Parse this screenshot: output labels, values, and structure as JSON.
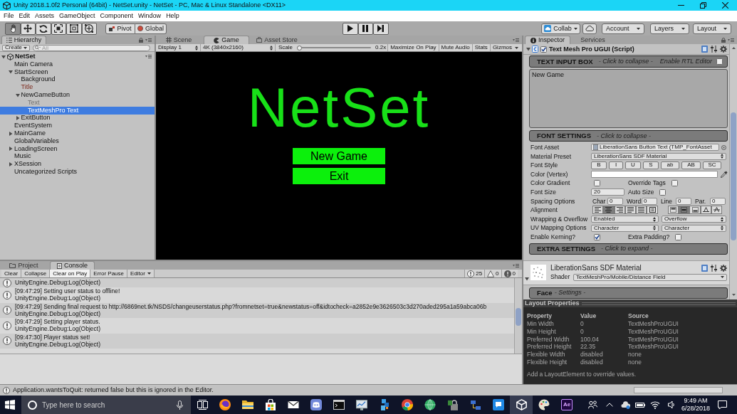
{
  "window": {
    "title": "Unity 2018.1.0f2 Personal (64bit) - NetSet.unity - NetSet - PC, Mac & Linux Standalone <DX11>"
  },
  "menu": [
    "File",
    "Edit",
    "Assets",
    "GameObject",
    "Component",
    "Window",
    "Help"
  ],
  "toolbar": {
    "tools": [
      {
        "kind": "hand",
        "selected": true
      },
      {
        "kind": "move",
        "selected": false
      },
      {
        "kind": "rotate",
        "selected": false
      },
      {
        "kind": "scale",
        "selected": false
      },
      {
        "kind": "rect",
        "selected": false
      },
      {
        "kind": "transform",
        "selected": false
      }
    ],
    "pivot": "Pivot",
    "space": "Global",
    "collab": "Collab",
    "account": "Account",
    "layers": "Layers",
    "layout": "Layout"
  },
  "hierarchy": {
    "tab": "Hierarchy",
    "create": "Create",
    "search": {
      "placeholder": "All"
    },
    "scene": {
      "name": "NetSet",
      "expanded": true,
      "children": [
        {
          "name": "Main Camera",
          "kind": "object",
          "selected": false
        },
        {
          "name": "StartScreen",
          "kind": "object",
          "selected": false,
          "expanded": true,
          "children": [
            {
              "name": "Background",
              "kind": "object",
              "selected": false
            },
            {
              "name": "Title",
              "kind": "missing_prefab",
              "selected": false
            },
            {
              "name": "NewGameButton",
              "kind": "object",
              "selected": false,
              "expanded": true,
              "children": [
                {
                  "name": "Text",
                  "kind": "inactive",
                  "selected": false
                },
                {
                  "name": "TextMeshPro Text",
                  "kind": "object",
                  "selected": true
                }
              ]
            },
            {
              "name": "ExitButton",
              "kind": "object",
              "selected": false,
              "expanded": false
            }
          ]
        },
        {
          "name": "EventSystem",
          "kind": "object",
          "selected": false
        },
        {
          "name": "MainGame",
          "kind": "object",
          "selected": false,
          "expanded": false
        },
        {
          "name": "GlobalVariables",
          "kind": "object",
          "selected": false
        },
        {
          "name": "LoadingScreen",
          "kind": "object",
          "selected": false,
          "expanded": false
        },
        {
          "name": "Music",
          "kind": "object",
          "selected": false
        },
        {
          "name": "XSession",
          "kind": "object",
          "selected": false,
          "expanded": false
        },
        {
          "name": "Uncategorized Scripts",
          "kind": "object",
          "selected": false
        }
      ]
    }
  },
  "view": {
    "tabs": [
      {
        "label": "Scene",
        "kind": "scene",
        "selected": false
      },
      {
        "label": "Game",
        "kind": "game",
        "selected": true
      },
      {
        "label": "Asset Store",
        "kind": "store",
        "selected": false
      }
    ],
    "display": "Display 1",
    "resolution": "4K (3840x2160)",
    "scale_label": "Scale",
    "scale": {
      "level": 0.03
    },
    "scale_value": "0.2x",
    "toggles": [
      {
        "label": "Maximize On Play",
        "on": false
      },
      {
        "label": "Mute Audio",
        "on": false
      },
      {
        "label": "Stats",
        "on": false
      }
    ],
    "gizmos": "Gizmos",
    "game": {
      "title": "NetSet",
      "buttons": [
        "New Game",
        "Exit"
      ]
    }
  },
  "inspector": {
    "tabs": [
      {
        "label": "Inspector",
        "kind": "inspector",
        "selected": true
      },
      {
        "label": "Services",
        "kind": "services",
        "selected": false
      }
    ],
    "component": {
      "title": "Text Mesh Pro UGUI (Script)",
      "expanded": true,
      "enabled": true
    },
    "text_input": {
      "heading": "TEXT INPUT BOX",
      "hint": "- Click to collapse -",
      "rtl_label": "Enable RTL Editor",
      "rtl_checked": false,
      "text": "New Game"
    },
    "font_settings": {
      "heading": "FONT SETTINGS",
      "hint": "- Click to collapse -",
      "rows": [
        {
          "kind": "object",
          "label": "Font Asset",
          "value": "LiberationSans Button Text (TMP_FontAsset"
        },
        {
          "kind": "dropdown",
          "label": "Material Preset",
          "value": "LiberationSans SDF Material"
        },
        {
          "kind": "buttons",
          "label": "Font Style",
          "buttons": [
            {
              "label": "B",
              "selected": false
            },
            {
              "label": "I",
              "selected": false
            },
            {
              "label": "U",
              "selected": false
            },
            {
              "label": "S",
              "selected": false
            },
            {
              "label": "ab",
              "selected": false
            },
            {
              "label": "AB",
              "selected": false
            },
            {
              "label": "SC",
              "selected": false
            }
          ]
        },
        {
          "kind": "color",
          "label": "Color (Vertex)",
          "color": "#ffffff"
        },
        {
          "kind": "toggles",
          "label": "Color Gradient",
          "checked": false,
          "label_2": "Override Tags",
          "checked_2": false
        },
        {
          "kind": "number",
          "label": "Font Size",
          "value": "20",
          "label_2": "Auto Size",
          "checked_2": false
        },
        {
          "kind": "spacing",
          "label": "Spacing Options",
          "fields": [
            {
              "label": "Char",
              "value": "0"
            },
            {
              "label": "Word",
              "value": "0"
            },
            {
              "label": "Line",
              "value": "0"
            },
            {
              "label": "Par.",
              "value": "0"
            }
          ]
        },
        {
          "kind": "alignment",
          "label": "Alignment",
          "horizontal": [
            {
              "kind": "left",
              "selected": false
            },
            {
              "kind": "center",
              "selected": true
            },
            {
              "kind": "right",
              "selected": false
            },
            {
              "kind": "justified",
              "selected": false
            },
            {
              "kind": "flush",
              "selected": false
            },
            {
              "kind": "geometry",
              "selected": false
            }
          ],
          "vertical": [
            {
              "kind": "top",
              "selected": false
            },
            {
              "kind": "middle",
              "selected": true
            },
            {
              "kind": "bottom",
              "selected": false
            },
            {
              "kind": "baseline",
              "selected": false
            },
            {
              "kind": "midline",
              "selected": false
            }
          ]
        },
        {
          "kind": "dropdowns",
          "label": "Wrapping & Overflow",
          "value": "Enabled",
          "value_2": "Overflow"
        },
        {
          "kind": "dropdowns",
          "label": "UV Mapping Options",
          "value": "Character",
          "value_2": "Character"
        },
        {
          "kind": "toggles",
          "label": "Enable Kerning?",
          "checked": true,
          "label_2": "Extra Padding?",
          "checked_2": false
        }
      ]
    },
    "extra_settings": {
      "heading": "EXTRA SETTINGS",
      "hint": "- Click to expand -"
    },
    "material": {
      "name": "LiberationSans SDF Material",
      "shader_label": "Shader",
      "shader": "TextMeshPro/Mobile/Distance Field"
    },
    "face": {
      "heading": "Face",
      "hint": "- Settings -"
    }
  },
  "layout_properties": {
    "title": "Layout Properties",
    "columns": [
      "Property",
      "Value",
      "Source"
    ],
    "rows": [
      [
        "Min Width",
        "0",
        "TextMeshProUGUI"
      ],
      [
        "Min Height",
        "0",
        "TextMeshProUGUI"
      ],
      [
        "Preferred Width",
        "100.04",
        "TextMeshProUGUI"
      ],
      [
        "Preferred Height",
        "22.35",
        "TextMeshProUGUI"
      ],
      [
        "Flexible Width",
        "disabled",
        "none"
      ],
      [
        "Flexible Height",
        "disabled",
        "none"
      ]
    ],
    "note": "Add a LayoutElement to override values."
  },
  "console": {
    "tabs": [
      {
        "label": "Project",
        "kind": "project",
        "selected": false
      },
      {
        "label": "Console",
        "kind": "console",
        "selected": true
      }
    ],
    "buttons": [
      {
        "label": "Clear",
        "on": false
      },
      {
        "label": "Collapse",
        "on": false
      },
      {
        "label": "Clear on Play",
        "on": true
      },
      {
        "label": "Error Pause",
        "on": false
      }
    ],
    "editor": "Editor",
    "counts": [
      {
        "kind": "info",
        "count": "25"
      },
      {
        "kind": "warning",
        "count": "0"
      },
      {
        "kind": "error",
        "count": "0"
      }
    ],
    "entries": [
      {
        "lines": [
          "UnityEngine.Debug:Log(Object)"
        ]
      },
      {
        "lines": [
          "[09:47:29] Setting user status to offline!",
          "UnityEngine.Debug:Log(Object)"
        ]
      },
      {
        "lines": [
          "[09:47:29] Sending final request to http://6869net.tk/NSDS/changeuserstatus.php?fromnetset=true&newstatus=off&idtocheck=a2852e9e3626503c3d270aded295a1a59abca06b",
          "UnityEngine.Debug:Log(Object)"
        ]
      },
      {
        "lines": [
          "[09:47:29] Setting player status.",
          "UnityEngine.Debug:Log(Object)"
        ]
      },
      {
        "lines": [
          "[09:47:30] Player status set!",
          "UnityEngine.Debug:Log(Object)"
        ]
      }
    ]
  },
  "status_bar": {
    "message": "Application.wantsToQuit: returned false but this is ignored in the Editor."
  },
  "taskbar": {
    "search": {
      "placeholder": "Type here to search"
    },
    "apps": [
      {
        "kind": "firefox",
        "active": false
      },
      {
        "kind": "explorer",
        "active": false
      },
      {
        "kind": "store",
        "active": false
      },
      {
        "kind": "mail",
        "active": false
      },
      {
        "kind": "discord",
        "active": false
      },
      {
        "kind": "terminal",
        "active": false
      },
      {
        "kind": "monitor",
        "active": false
      },
      {
        "kind": "blocks",
        "active": false
      },
      {
        "kind": "chrome",
        "active": false
      },
      {
        "kind": "globe",
        "active": false
      },
      {
        "kind": "lock",
        "active": false
      },
      {
        "kind": "network",
        "active": false
      },
      {
        "kind": "chat",
        "active": false
      },
      {
        "kind": "unity",
        "active": true
      },
      {
        "kind": "palette",
        "active": false
      },
      {
        "kind": "ae",
        "label": "Ae",
        "active": false
      }
    ],
    "time": "9:49 AM",
    "date": "6/28/2018"
  }
}
